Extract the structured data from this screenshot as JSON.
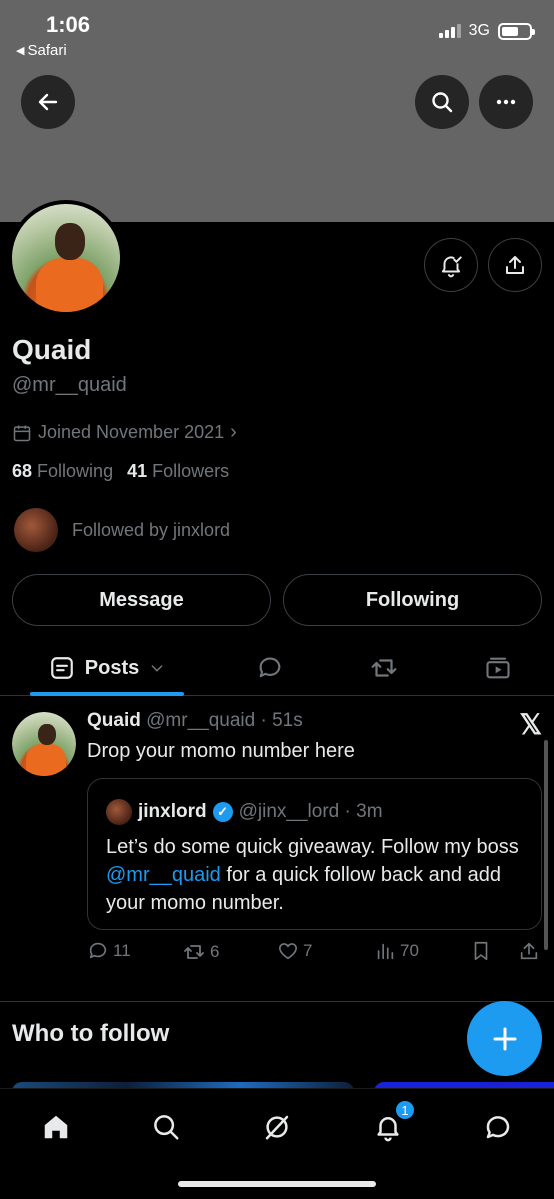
{
  "status_bar": {
    "time": "1:06",
    "back_app": "Safari",
    "network": "3G",
    "battery_level": 0.6
  },
  "profile": {
    "name": "Quaid",
    "handle": "@mr__quaid",
    "joined": "Joined November 2021",
    "following_count": "68",
    "following_label": "Following",
    "followers_count": "41",
    "followers_label": "Followers",
    "followed_by": "Followed by jinxlord"
  },
  "buttons": {
    "message": "Message",
    "following": "Following"
  },
  "tabs": {
    "posts": "Posts"
  },
  "post": {
    "author_name": "Quaid",
    "author_meta": "@mr__quaid · 51s",
    "text": "Drop your momo number here",
    "quote": {
      "author_name": "jinxlord",
      "author_meta": "@jinx__lord · 3m",
      "text_before": "Let’s do some quick giveaway. Follow my boss ",
      "mention": "@mr__quaid",
      "text_after": " for a quick follow back and add your momo number."
    },
    "actions": {
      "replies": "11",
      "reposts": "6",
      "likes": "7",
      "views": "70"
    }
  },
  "who_to_follow": {
    "title": "Who to follow"
  },
  "nav": {
    "notifications_badge": "1"
  },
  "colors": {
    "accent": "#1d9bf0",
    "background": "#000000",
    "muted": "#71767b",
    "banner": "#656565"
  }
}
